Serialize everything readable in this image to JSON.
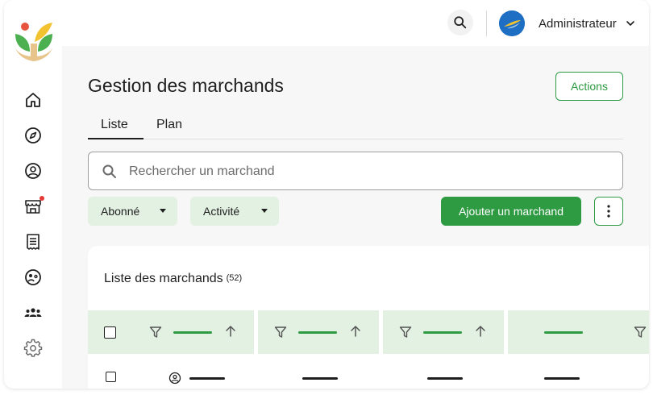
{
  "topbar": {
    "user_name": "Administrateur",
    "icons": [
      "search-icon",
      "avatar",
      "chevron-down-icon"
    ]
  },
  "sidebar": {
    "items": [
      {
        "icon": "home-icon"
      },
      {
        "icon": "compass-icon"
      },
      {
        "icon": "user-circle-icon"
      },
      {
        "icon": "store-icon",
        "badge": true
      },
      {
        "icon": "receipt-icon"
      },
      {
        "icon": "face-icon"
      },
      {
        "icon": "group-icon"
      },
      {
        "icon": "gear-icon"
      }
    ]
  },
  "page": {
    "title": "Gestion des marchands",
    "actions_label": "Actions",
    "tabs": [
      {
        "label": "Liste",
        "active": true
      },
      {
        "label": "Plan",
        "active": false
      }
    ]
  },
  "search": {
    "placeholder": "Rechercher un marchand",
    "value": ""
  },
  "filters": [
    {
      "label": "Abonné"
    },
    {
      "label": "Activité"
    }
  ],
  "toolbar": {
    "add_label": "Ajouter un marchand"
  },
  "list": {
    "title": "Liste des marchands",
    "count": "(52)"
  },
  "colors": {
    "accent": "#2e9a42",
    "accent_light": "#e3f1e3",
    "badge": "#e53935",
    "background": "#f7f7f7"
  }
}
